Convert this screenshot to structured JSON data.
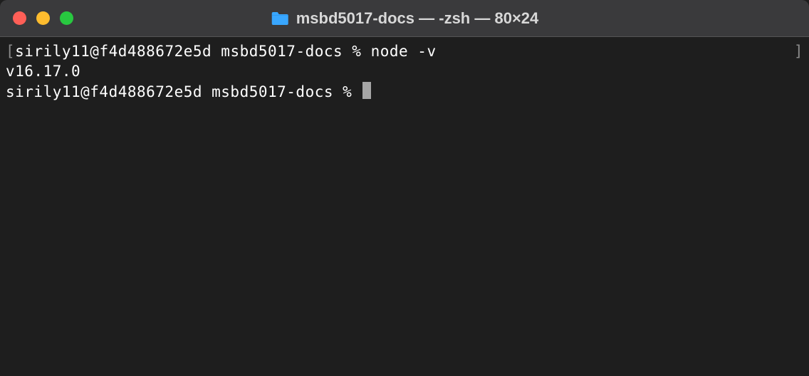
{
  "window": {
    "title": "msbd5017-docs — -zsh — 80×24"
  },
  "terminal": {
    "line1_left_bracket": "[",
    "line1_prompt": "sirily11@f4d488672e5d msbd5017-docs % ",
    "line1_command": "node -v",
    "line1_right_bracket": "]",
    "line2_output": "v16.17.0",
    "line3_prompt": "sirily11@f4d488672e5d msbd5017-docs % "
  }
}
